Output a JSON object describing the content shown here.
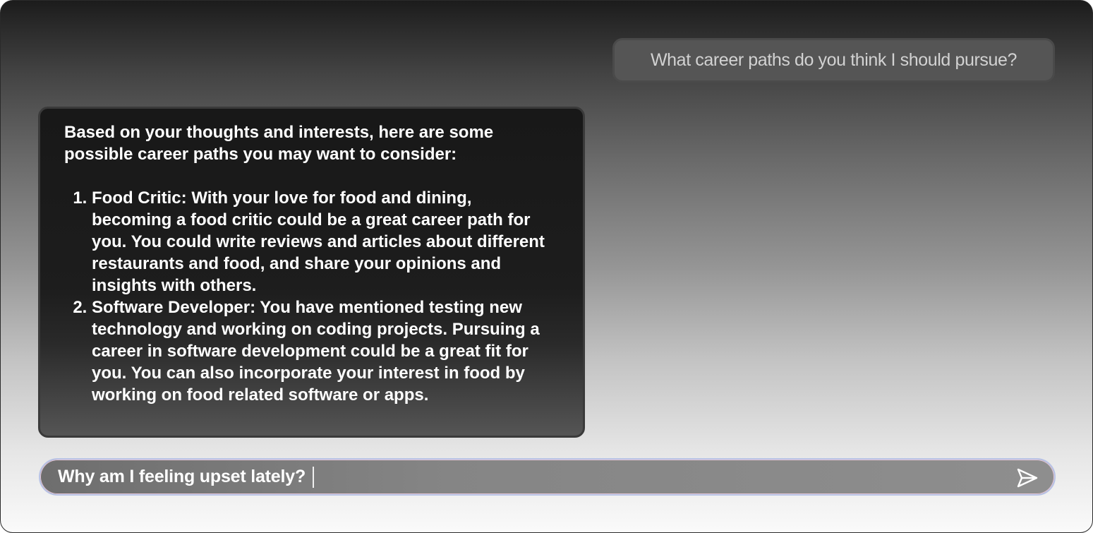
{
  "chat": {
    "user_message": "What career paths do you think I should pursue?",
    "assistant": {
      "intro": "Based on your thoughts and interests, here are some possible career paths you may want to consider:",
      "items": [
        "Food Critic: With your love for food and dining, becoming a food critic could be a great career path for you. You could write reviews and articles about different restaurants and food, and share your opinions and insights with others.",
        "Software Developer: You have mentioned testing new technology and working on coding projects. Pursuing a career in software development could be a great fit for you. You can also incorporate your interest in food by working on food related software or apps."
      ]
    }
  },
  "composer": {
    "value": "Why am I feeling upset lately?",
    "send_icon": "send-icon"
  },
  "colors": {
    "input_border": "#b8c3e6",
    "bubble_dark": "#181818",
    "user_bubble": "#555555"
  }
}
